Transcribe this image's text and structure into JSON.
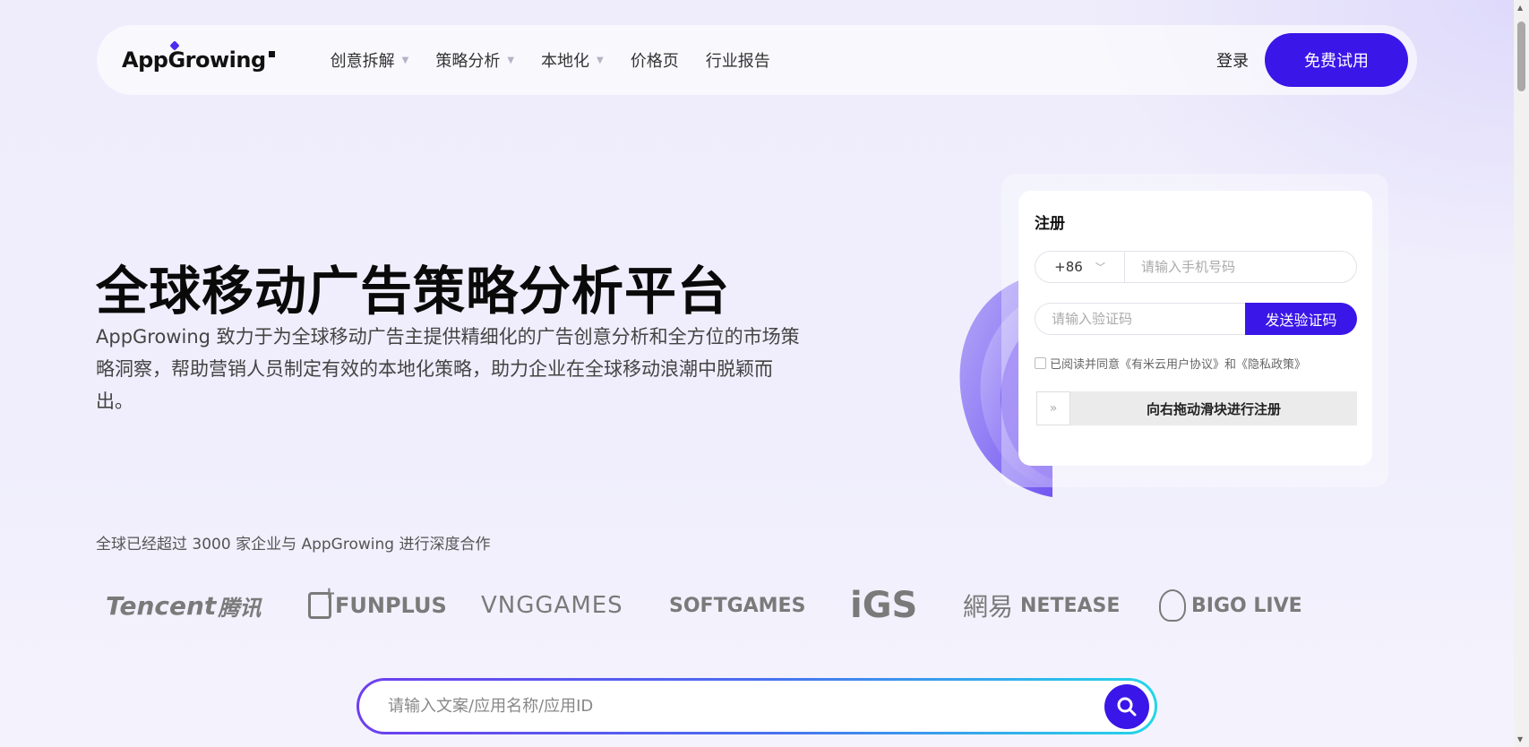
{
  "nav": {
    "logo_text_a": "App",
    "logo_text_g": "G",
    "logo_text_b": "rowing",
    "items": [
      {
        "label": "创意拆解",
        "has_dropdown": true
      },
      {
        "label": "策略分析",
        "has_dropdown": true
      },
      {
        "label": "本地化",
        "has_dropdown": true
      },
      {
        "label": "价格页",
        "has_dropdown": false
      },
      {
        "label": "行业报告",
        "has_dropdown": false
      }
    ],
    "login_label": "登录",
    "trial_label": "免费试用"
  },
  "hero": {
    "title": "全球移动广告策略分析平台",
    "description": "AppGrowing 致力于为全球移动广告主提供精细化的广告创意分析和全方位的市场策略洞察，帮助营销人员制定有效的本地化策略，助力企业在全球移动浪潮中脱颖而出。"
  },
  "register": {
    "title": "注册",
    "country_code": "+86",
    "phone_placeholder": "请输入手机号码",
    "code_placeholder": "请输入验证码",
    "send_code_label": "发送验证码",
    "agree_text": "已阅读并同意《有米云用户协议》和《隐私政策》",
    "slider_text": "向右拖动滑块进行注册",
    "slider_handle": "»"
  },
  "partners": {
    "title": "全球已经超过 3000 家企业与 AppGrowing 进行深度合作",
    "logos": {
      "tencent_en": "Tencent",
      "tencent_cn": "腾讯",
      "funplus": "FUNPLUS",
      "vng": "VNGGAMES",
      "softgames": "SOFTGAMES",
      "igs": "iGS",
      "netease_cn": "網易",
      "netease_en": "NETEASE",
      "bigo": "BIGO LIVE"
    }
  },
  "search": {
    "placeholder": "请输入文案/应用名称/应用ID"
  },
  "colors": {
    "accent": "#3b16e8",
    "background": "#efedfb",
    "logo_gray": "#7a7a7a"
  },
  "icons": {
    "dropdown": "caret-down-icon",
    "search": "magnifier-icon"
  }
}
